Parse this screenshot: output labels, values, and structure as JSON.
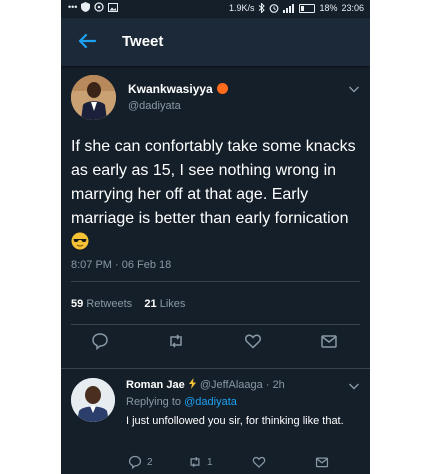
{
  "status_bar": {
    "left_icons": [
      "dots-icon",
      "shield-icon",
      "whatsapp-icon",
      "image-icon"
    ],
    "dots": "•••",
    "speed": "1.9K/s",
    "battery": "18%",
    "time": "23:06"
  },
  "header": {
    "title": "Tweet"
  },
  "tweet": {
    "author_name": "Kwankwasiyya",
    "author_handle": "@dadiyata",
    "text": "If she can confortably take some knacks as early as 15, I see nothing wrong in marrying her off at that age. Early marriage is better than early fornication",
    "timestamp": "8:07 PM · 06 Feb 18",
    "retweets_count": "59",
    "retweets_label": "Retweets",
    "likes_count": "21",
    "likes_label": "Likes"
  },
  "reply": {
    "author_name": "Roman Jae",
    "author_handle": "@JeffAlaaga",
    "time": "· 2h",
    "replying_prefix": "Replying to",
    "replying_to": "@dadiyata",
    "text": "I just unfollowed you sir, for thinking like that.",
    "reply_count": "2",
    "retweet_count": "1"
  },
  "colors": {
    "background": "#151f2a",
    "header": "#1c2938",
    "secondary_text": "#8899a6",
    "accent": "#1da1f2",
    "verified_badge": "#ff6b1a"
  }
}
